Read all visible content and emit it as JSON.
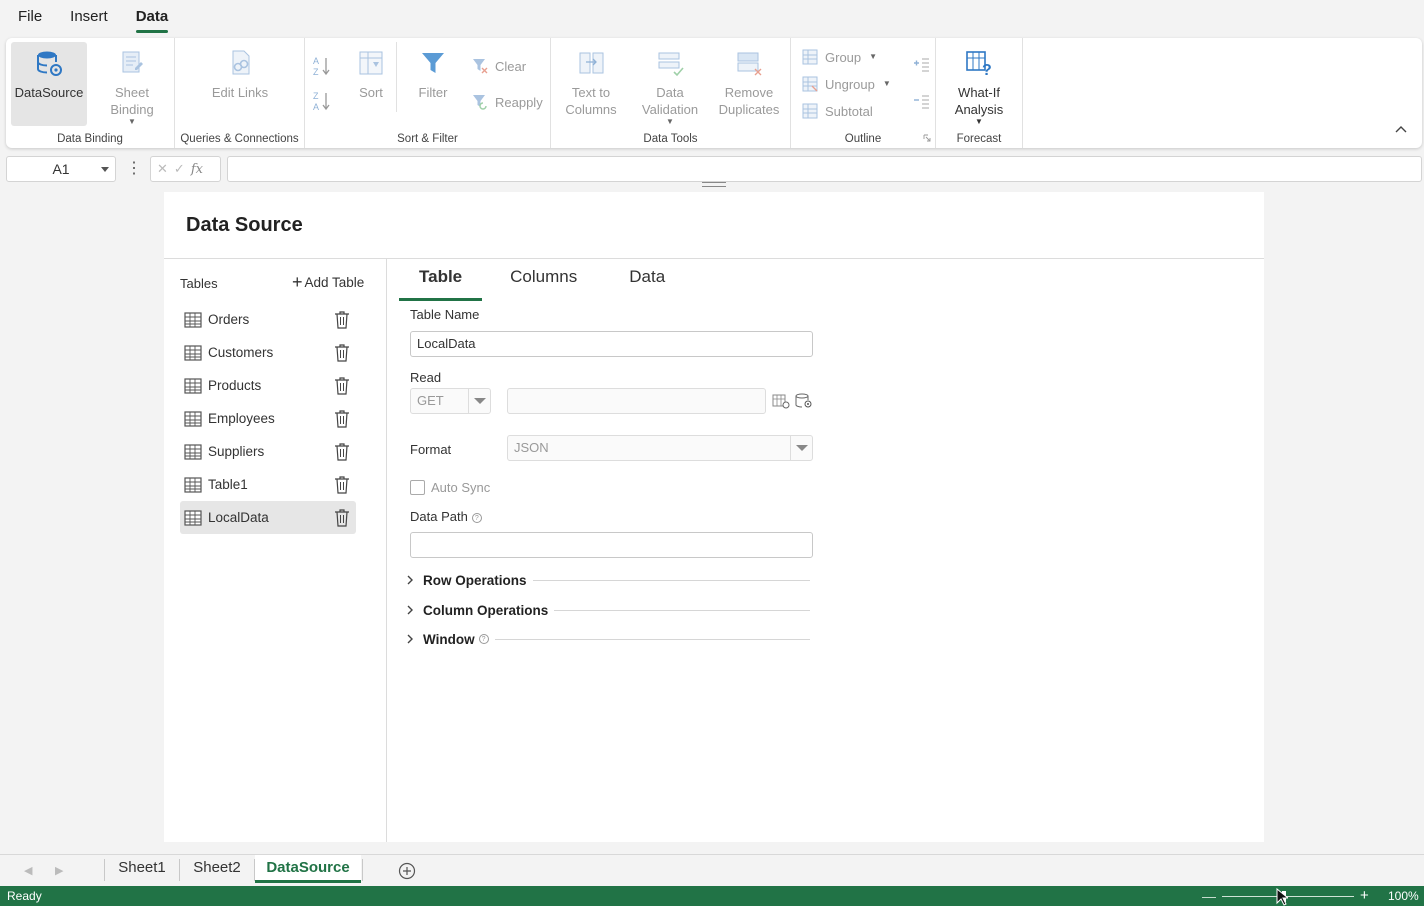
{
  "menu": {
    "file": "File",
    "insert": "Insert",
    "data": "Data"
  },
  "ribbon": {
    "datasource": "DataSource",
    "sheet_binding_1": "Sheet",
    "sheet_binding_2": "Binding",
    "group_data_binding": "Data Binding",
    "edit_links": "Edit Links",
    "group_queries": "Queries & Connections",
    "sort": "Sort",
    "filter": "Filter",
    "clear": "Clear",
    "reapply": "Reapply",
    "group_sort_filter": "Sort & Filter",
    "text_to_columns_1": "Text to",
    "text_to_columns_2": "Columns",
    "data_validation_1": "Data",
    "data_validation_2": "Validation",
    "remove_duplicates_1": "Remove",
    "remove_duplicates_2": "Duplicates",
    "group_data_tools": "Data Tools",
    "group": "Group",
    "ungroup": "Ungroup",
    "subtotal": "Subtotal",
    "group_outline": "Outline",
    "whatif_1": "What-If",
    "whatif_2": "Analysis",
    "group_forecast": "Forecast"
  },
  "formula_bar": {
    "name_box": "A1",
    "fx": "fx",
    "formula": ""
  },
  "panel": {
    "title": "Data Source",
    "tables_label": "Tables",
    "add_table": "Add Table",
    "tables": [
      "Orders",
      "Customers",
      "Products",
      "Employees",
      "Suppliers",
      "Table1",
      "LocalData"
    ],
    "selected_table": "LocalData",
    "tabs": [
      "Table",
      "Columns",
      "Data"
    ],
    "active_tab": "Table",
    "table_name_label": "Table Name",
    "table_name_value": "LocalData",
    "read_label": "Read",
    "read_method": "GET",
    "read_url": "",
    "format_label": "Format",
    "format_value": "JSON",
    "auto_sync_label": "Auto Sync",
    "auto_sync_checked": false,
    "data_path_label": "Data Path",
    "data_path_value": "",
    "sections": [
      "Row Operations",
      "Column Operations",
      "Window"
    ]
  },
  "sheets": {
    "tabs": [
      "Sheet1",
      "Sheet2",
      "DataSource"
    ],
    "active": "DataSource"
  },
  "status": {
    "text": "Ready",
    "zoom": "100%",
    "zoom_fraction": 0.5
  },
  "colors": {
    "accent": "#217346",
    "icon_blue": "#2f78c4",
    "disabled": "#9a9a9a"
  }
}
